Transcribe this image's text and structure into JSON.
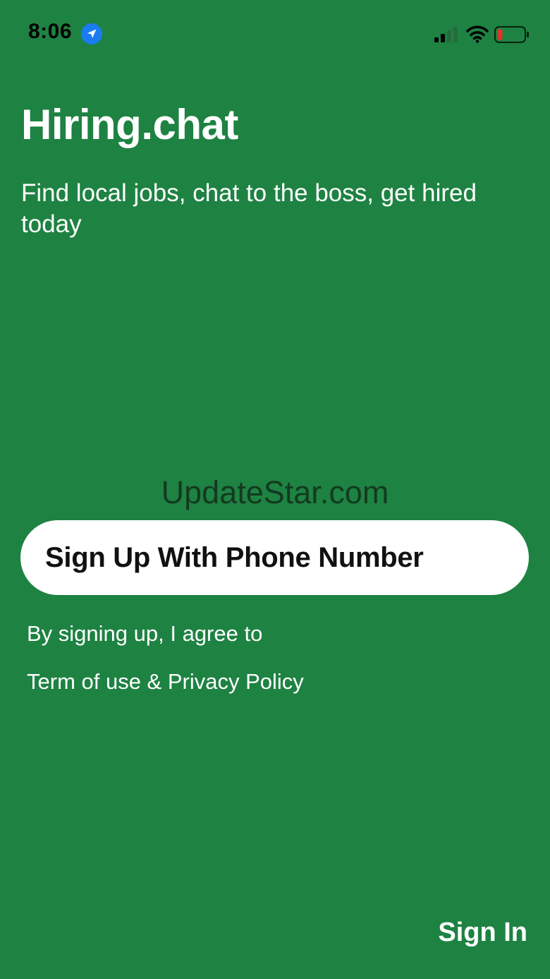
{
  "status_bar": {
    "time": "8:06",
    "icons": {
      "location": "location-arrow-icon",
      "cellular": "cellular-signal-icon",
      "wifi": "wifi-icon",
      "battery": "battery-low-icon"
    }
  },
  "header": {
    "title": "Hiring.chat",
    "tagline": "Find local jobs, chat to the boss, get hired today"
  },
  "watermark": "UpdateStar.com",
  "signup": {
    "button_label": "Sign Up With Phone Number",
    "agree_text": "By signing up, I agree to",
    "terms_link": "Term of use & Privacy Policy"
  },
  "footer": {
    "signin_label": "Sign In"
  },
  "colors": {
    "background": "#1e8242",
    "button_bg": "#ffffff",
    "button_text": "#111111",
    "location_badge": "#1a7cf0",
    "battery_low": "#e5312b"
  }
}
